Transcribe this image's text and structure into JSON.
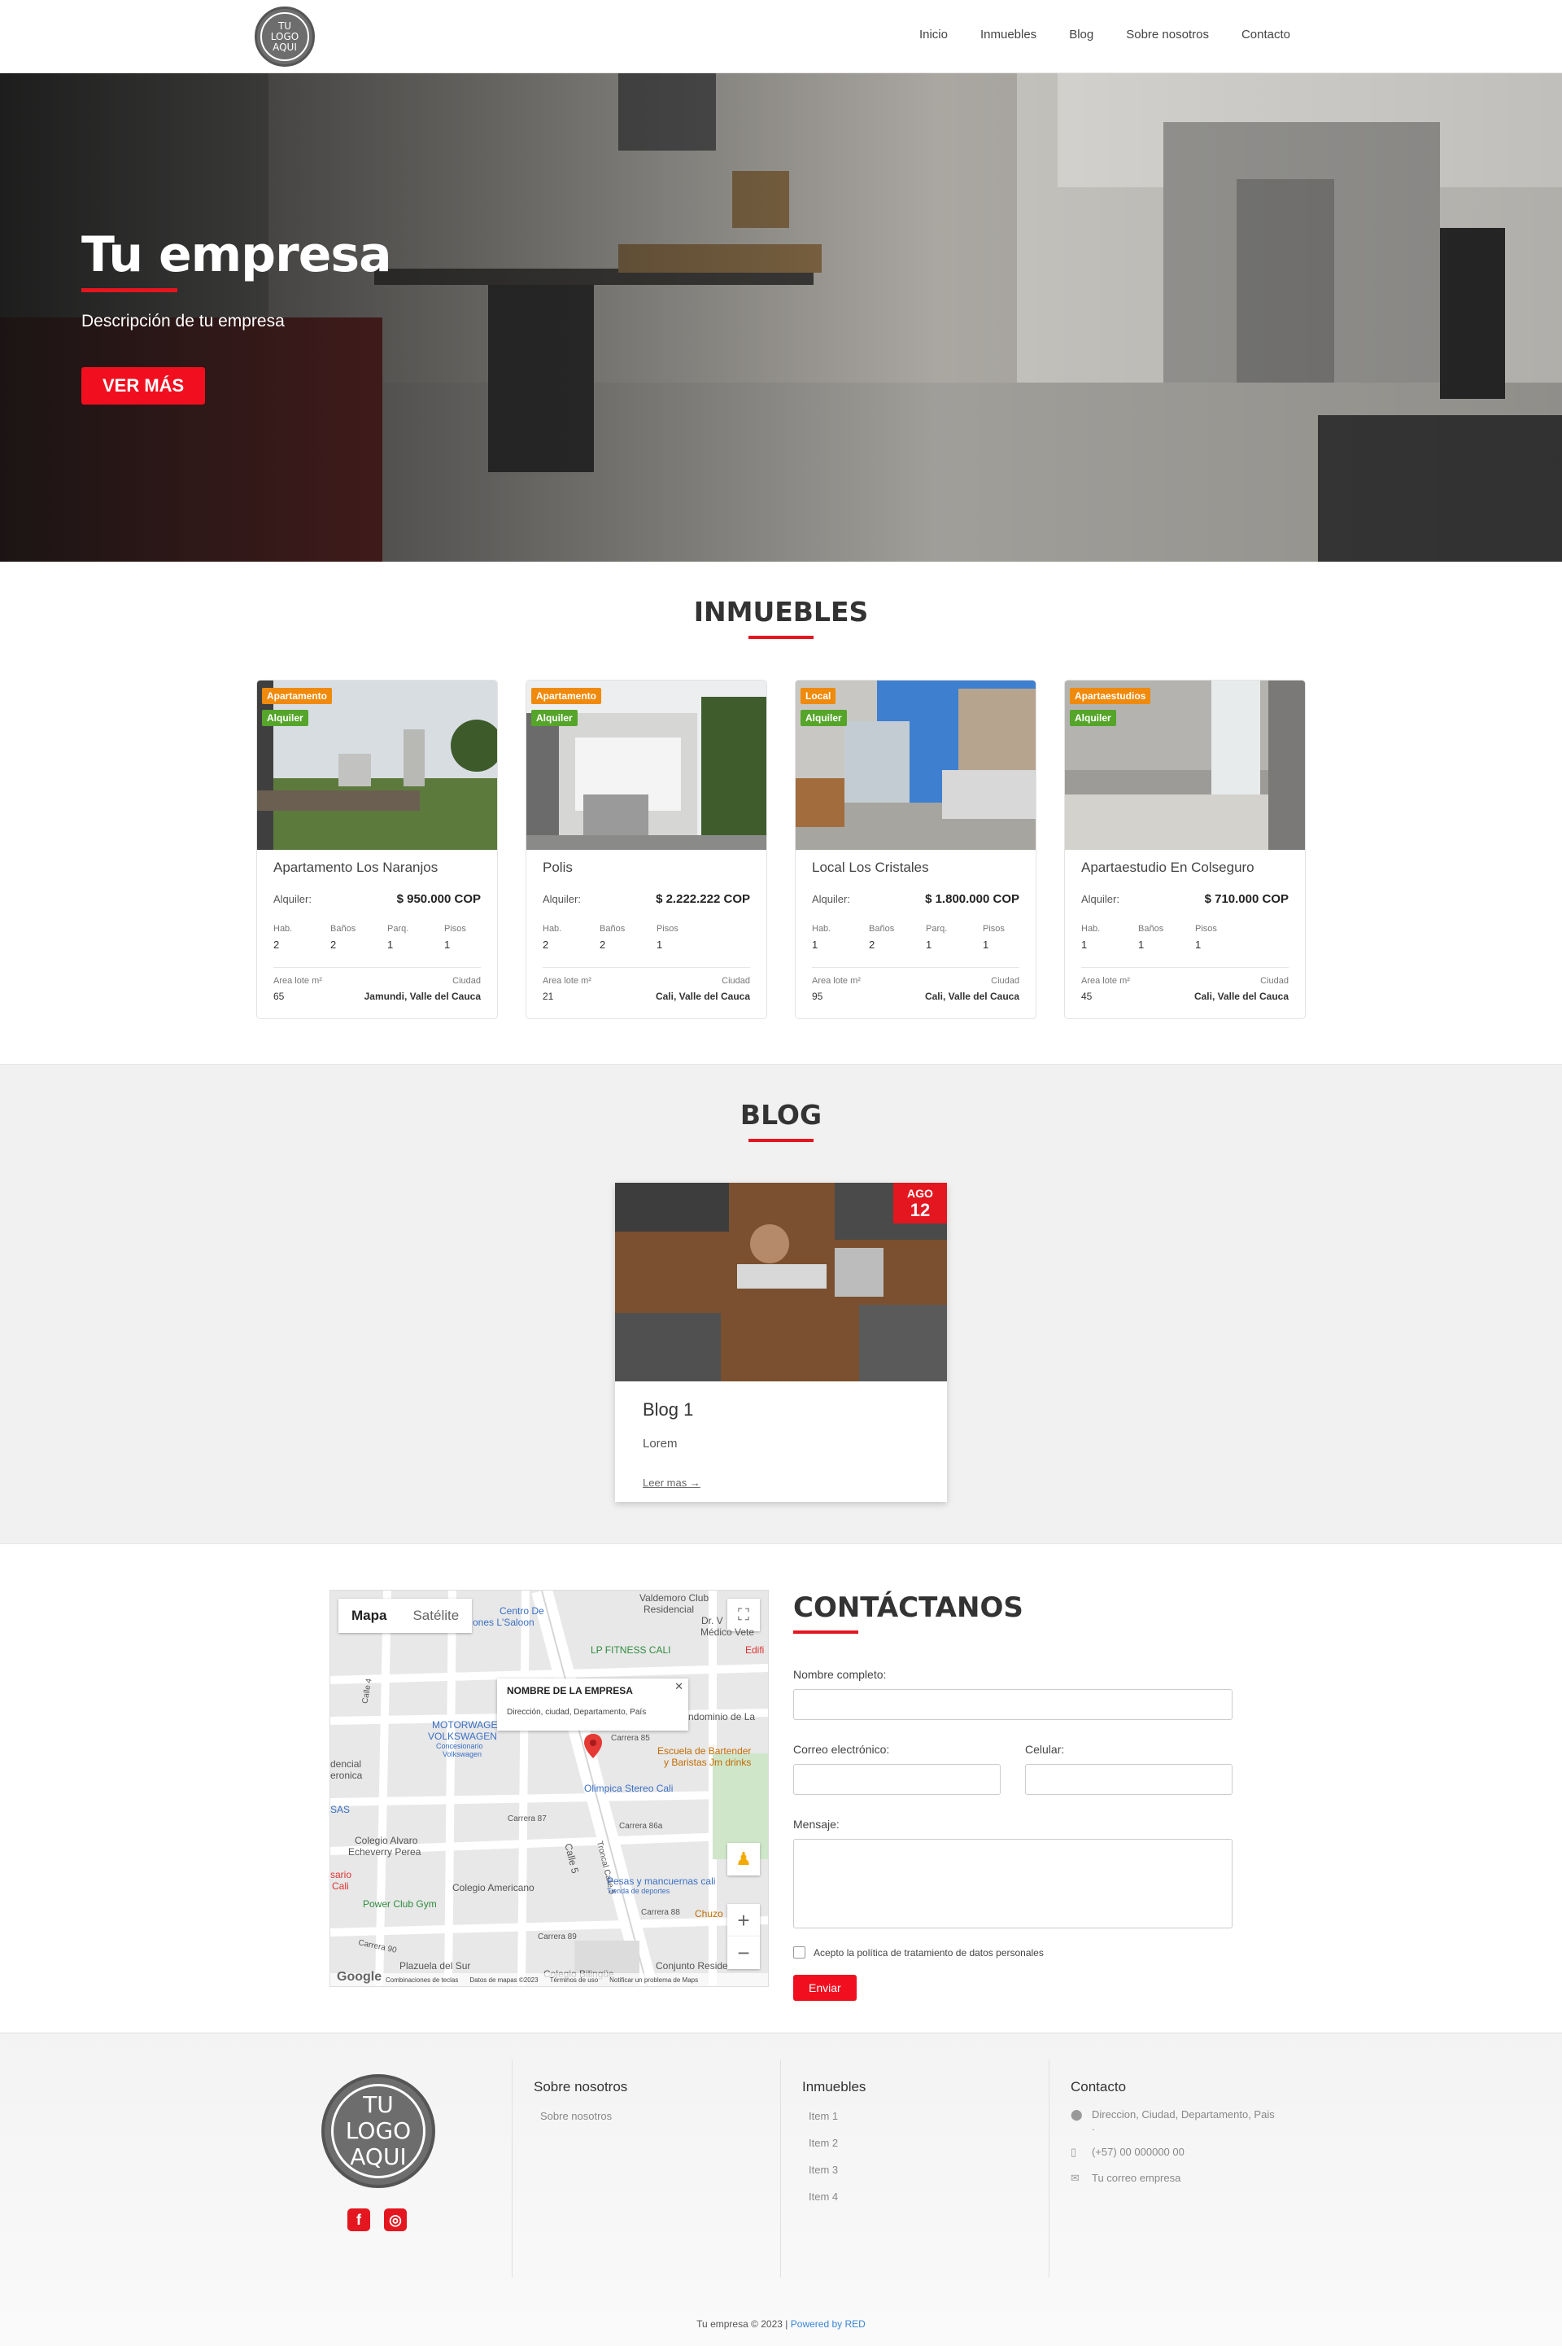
{
  "nav": {
    "logo": [
      "TU",
      "LOGO",
      "AQUI"
    ],
    "items": [
      "Inicio",
      "Inmuebles",
      "Blog",
      "Sobre nosotros",
      "Contacto"
    ]
  },
  "hero": {
    "title": "Tu empresa",
    "subtitle": "Descripción de tu empresa",
    "button": "VER MÁS"
  },
  "inmuebles": {
    "title": "INMUEBLES",
    "cards": [
      {
        "type": "Apartamento",
        "op": "Alquiler",
        "title": "Apartamento Los Naranjos",
        "price_label": "Alquiler:",
        "price": "$ 950.000 COP",
        "hab": "2",
        "banos": "2",
        "parq": "1",
        "pisos": "1",
        "area_label": "Area lote m²",
        "area": "65",
        "city_label": "Ciudad",
        "city": "Jamundi, Valle del Cauca"
      },
      {
        "type": "Apartamento",
        "op": "Alquiler",
        "title": "Polis",
        "price_label": "Alquiler:",
        "price": "$ 2.222.222 COP",
        "hab": "2",
        "banos": "2",
        "parq": "",
        "pisos": "1",
        "area_label": "Area lote m²",
        "area": "21",
        "city_label": "Ciudad",
        "city": "Cali, Valle del Cauca"
      },
      {
        "type": "Local",
        "op": "Alquiler",
        "title": "Local Los Cristales",
        "price_label": "Alquiler:",
        "price": "$ 1.800.000 COP",
        "hab": "1",
        "banos": "2",
        "parq": "1",
        "pisos": "1",
        "area_label": "Area lote m²",
        "area": "95",
        "city_label": "Ciudad",
        "city": "Cali, Valle del Cauca"
      },
      {
        "type": "Apartaestudios",
        "op": "Alquiler",
        "title": "Apartaestudio En Colseguro",
        "price_label": "Alquiler:",
        "price": "$ 710.000 COP",
        "hab": "1",
        "banos": "1",
        "parq": "",
        "pisos": "1",
        "area_label": "Area lote m²",
        "area": "45",
        "city_label": "Ciudad",
        "city": "Cali, Valle del Cauca"
      }
    ],
    "labels": {
      "hab": "Hab.",
      "banos": "Baños",
      "parq": "Parq.",
      "pisos": "Pisos"
    }
  },
  "blog": {
    "title": "BLOG",
    "post": {
      "month": "AGO",
      "day": "12",
      "title": "Blog 1",
      "excerpt": "Lorem",
      "link": "Leer mas →"
    }
  },
  "contact": {
    "map": {
      "tab_map": "Mapa",
      "tab_sat": "Satélite",
      "popup_name": "NOMBRE DE LA EMPRESA",
      "popup_address": "Dirección, ciudad, Departamento, País",
      "labels": {
        "valdemoro": "Valdemoro Club",
        "residencial": "Residencial",
        "centro": "Centro De",
        "saloon": "ones L'Saloon",
        "lp": "LP FITNESS CALI",
        "dr": "Dr. V",
        "medico": "Médico Vete",
        "edifi": "Edifi",
        "ndominio": "ndominio de La",
        "motor": "MOTORWAGEN",
        "vw": "VOLKSWAGEN",
        "conces": "Concesionario",
        "conces2": "Volkswagen",
        "calle4": "Calle 4",
        "carrera85": "Carrera 85",
        "escuela": "Escuela de Bartender",
        "escuela2": "y Baristas Jm drinks",
        "olimpica": "Olimpica Stereo Cali",
        "dencial": "dencial",
        "eronica": "eronica",
        "sas": "SAS",
        "carrera87": "Carrera 87",
        "carrera86a": "Carrera 86a",
        "colegio": "Colegio Alvaro",
        "echeverry": "Echeverry Perea",
        "troncal": "Troncal Calle 5",
        "calle5": "Calle 5",
        "pesas": "Pesas y mancuernas cali",
        "tienda": "Tienda de deportes",
        "scario": "sario",
        "cali": "Cali",
        "power": "Power Club Gym",
        "colegio_am": "Colegio Americano",
        "carrera88": "Carrera 88",
        "chuzo": "Chuzo",
        "carrera90": "Carrera 90",
        "carrera89": "Carrera 89",
        "plazuela": "Plazuela del Sur",
        "bilingue": "Colegio Bilingüe",
        "conjunto": "Conjunto Residencial"
      },
      "attrib": [
        "Combinaciones de teclas",
        "Datos de mapas ©2023",
        "Términos de uso",
        "Notificar un problema de Maps"
      ],
      "google": "Google"
    },
    "title": "CONTÁCTANOS",
    "fields": {
      "name": "Nombre completo:",
      "email": "Correo electrónico:",
      "phone": "Celular:",
      "message": "Mensaje:"
    },
    "consent": "Acepto la política de tratamiento de datos personales",
    "send": "Enviar"
  },
  "footer": {
    "logo": [
      "TU",
      "LOGO",
      "AQUI"
    ],
    "about_title": "Sobre nosotros",
    "about_items": [
      "Sobre nosotros"
    ],
    "inmuebles_title": "Inmuebles",
    "inmuebles_items": [
      "Item 1",
      "Item 2",
      "Item 3",
      "Item 4"
    ],
    "contact_title": "Contacto",
    "address": "Direccion, Ciudad, Departamento, Pais",
    "address_dot": ".",
    "phone": "(+57) 00 000000 00",
    "email": "Tu correo empresa",
    "copyright": "Tu empresa © 2023 |",
    "powered": "Powered by RED"
  },
  "colors": {
    "accent": "#e4161f",
    "badge_type": "#f08a0c",
    "badge_op": "#55a52a"
  },
  "icons": [
    "facebook-icon",
    "instagram-icon",
    "location-pin-icon",
    "phone-icon",
    "mail-icon",
    "fullscreen-icon",
    "pegman-icon",
    "zoom-in-icon",
    "zoom-out-icon"
  ]
}
